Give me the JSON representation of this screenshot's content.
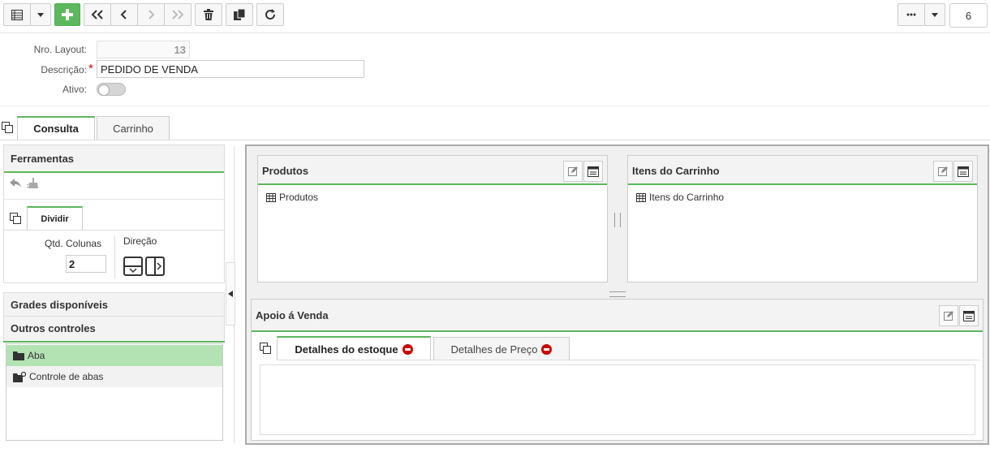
{
  "toolbar": {
    "items": [
      "table-view-icon",
      "dropdown-icon",
      "add-icon",
      "first-icon",
      "previous-icon",
      "next-icon",
      "last-icon",
      "delete-icon",
      "copy-icon",
      "refresh-icon"
    ],
    "more_icon": "more-icon",
    "record_count": "6"
  },
  "form": {
    "layout_number_label": "Nro. Layout:",
    "layout_number_value": "13",
    "description_label": "Descrição:",
    "required_mark": "*",
    "description_value": "PEDIDO DE VENDA",
    "active_label": "Ativo:",
    "active": false
  },
  "tabs": [
    {
      "label": "Consulta",
      "active": true
    },
    {
      "label": "Carrinho",
      "active": false
    }
  ],
  "tools": {
    "title": "Ferramentas",
    "split_tab": "Dividir",
    "columns_label": "Qtd. Colunas",
    "columns_value": "2",
    "direction_label": "Direção"
  },
  "available_grids_title": "Grades disponíveis",
  "other_controls": {
    "title": "Outros controles",
    "items": [
      {
        "label": "Aba",
        "selected": true
      },
      {
        "label": "Controle de abas",
        "selected": false
      }
    ]
  },
  "designer": {
    "products": {
      "title": "Produtos",
      "item": "Produtos"
    },
    "cart_items": {
      "title": "Itens do Carrinho",
      "item": "Itens do Carrinho"
    },
    "sales_support": {
      "title": "Apoio á Venda",
      "tabs": [
        {
          "label": "Detalhes do estoque",
          "active": true
        },
        {
          "label": "Detalhes de Preço",
          "active": false
        }
      ]
    }
  },
  "colors": {
    "accent": "#5cb85c",
    "selected_row": "#b3e3b3",
    "remove": "#cc0000"
  }
}
